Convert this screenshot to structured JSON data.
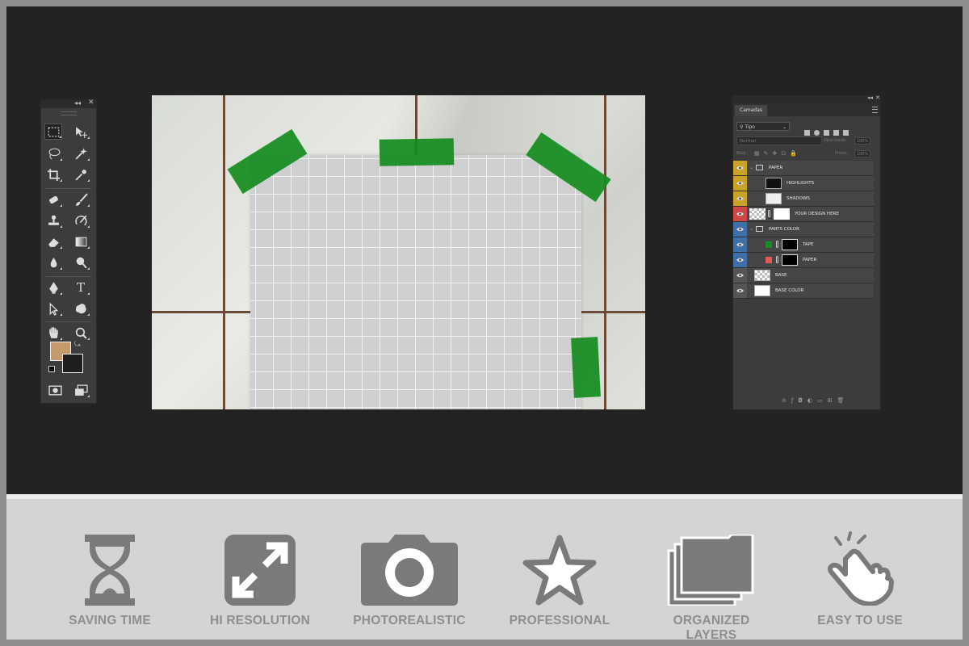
{
  "colors": {
    "frame": "#8d8d8d",
    "workspace": "#232323",
    "panel": "#3c3c3c",
    "feature_bg": "#d4d4d4",
    "feature_icon": "#7a7a7a",
    "feature_text": "#8e8e8e",
    "tape": "#148c1e",
    "foreground_color": "#c49a6c",
    "background_color": "#1f1f1f"
  },
  "tools_panel": {
    "tools": [
      {
        "icon": "marquee-icon",
        "active": true
      },
      {
        "icon": "move-icon"
      },
      {
        "icon": "lasso-icon"
      },
      {
        "icon": "magic-wand-icon"
      },
      {
        "icon": "crop-icon"
      },
      {
        "icon": "eyedropper-icon"
      },
      {
        "icon": "healing-brush-icon"
      },
      {
        "icon": "brush-icon"
      },
      {
        "icon": "clone-stamp-icon"
      },
      {
        "icon": "history-brush-icon"
      },
      {
        "icon": "eraser-icon"
      },
      {
        "icon": "gradient-icon"
      },
      {
        "icon": "blur-icon"
      },
      {
        "icon": "dodge-icon"
      },
      {
        "icon": "pen-icon"
      },
      {
        "icon": "type-icon"
      },
      {
        "icon": "path-selection-icon"
      },
      {
        "icon": "shape-icon"
      },
      {
        "icon": "hand-icon"
      },
      {
        "icon": "zoom-icon"
      }
    ],
    "type_tool_glyph": "T"
  },
  "layers_panel": {
    "tab": "Camadas",
    "filter": "Tipo",
    "blend_mode": "Normal",
    "opacity_label": "Opacidade:",
    "opacity_value": "100%",
    "lock_label": "Bloq.:",
    "fill_label": "Preen.:",
    "fill_value": "100%",
    "layers": [
      {
        "name": "PAPER",
        "type": "group",
        "label_color": "#c9a227",
        "indent": 0,
        "expanded": true
      },
      {
        "name": "HIGHLIGHTS",
        "type": "layer",
        "label_color": "#c9a227",
        "indent": 1,
        "thumb": "dark"
      },
      {
        "name": "SHADOWS",
        "type": "layer",
        "label_color": "#c9a227",
        "indent": 1,
        "thumb": "light"
      },
      {
        "name": "YOUR DESIGN HERE",
        "type": "smart",
        "label_color": "#d04545",
        "indent": 0,
        "thumb": "checker"
      },
      {
        "name": "PARTS COLOR",
        "type": "group",
        "label_color": "#3d6fa8",
        "indent": 0,
        "expanded": true
      },
      {
        "name": "TAPE",
        "type": "fill",
        "label_color": "#3d6fa8",
        "indent": 1,
        "swatch": "#1c8c2a"
      },
      {
        "name": "PAPER",
        "type": "fill",
        "label_color": "#3d6fa8",
        "indent": 1,
        "swatch": "#e05858"
      },
      {
        "name": "BASE",
        "type": "layer",
        "label_color": "#555555",
        "indent": 0,
        "thumb": "checker"
      },
      {
        "name": "BASE COLOR",
        "type": "layer",
        "label_color": "#555555",
        "indent": 0,
        "thumb": "white"
      }
    ],
    "bottom_icons": [
      "link-icon",
      "fx-icon",
      "mask-icon",
      "adjustment-icon",
      "folder-icon",
      "new-layer-icon",
      "trash-icon"
    ]
  },
  "features": [
    {
      "label": "SAVING TIME",
      "icon": "hourglass-icon"
    },
    {
      "label": "HI RESOLUTION",
      "icon": "expand-icon"
    },
    {
      "label": "PHOTOREALISTIC",
      "icon": "camera-icon"
    },
    {
      "label": "PROFESSIONAL",
      "icon": "star-icon"
    },
    {
      "label": "ORGANIZED LAYERS",
      "icon": "layers-icon"
    },
    {
      "label": "EASY TO USE",
      "icon": "pointer-hand-icon"
    }
  ]
}
